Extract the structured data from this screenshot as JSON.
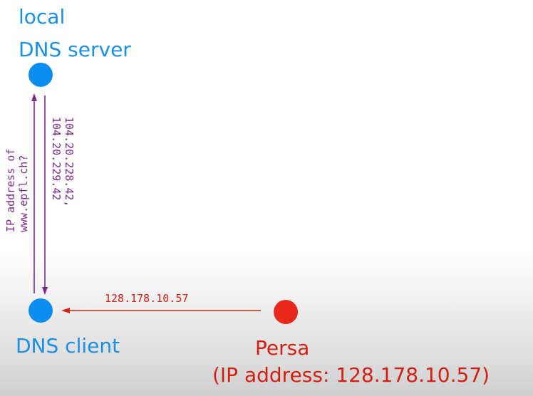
{
  "local_server": {
    "line1": "local",
    "line2": "DNS server",
    "color": "#1a8fe6"
  },
  "dns_client": {
    "label": "DNS client",
    "color": "#1a8fe6"
  },
  "persa": {
    "name": "Persa",
    "address_line": "(IP address: 128.178.10.57)",
    "color": "#d21f12"
  },
  "query": {
    "line1": "IP address of",
    "line2": "www.epfl.ch?",
    "color": "#7b2a8c"
  },
  "response": {
    "line1": "104.20.228.42,",
    "line2": "104.20.229.42",
    "color": "#7b2a8c"
  },
  "spoof": {
    "label": "128.178.10.57",
    "color": "#d21f12"
  }
}
